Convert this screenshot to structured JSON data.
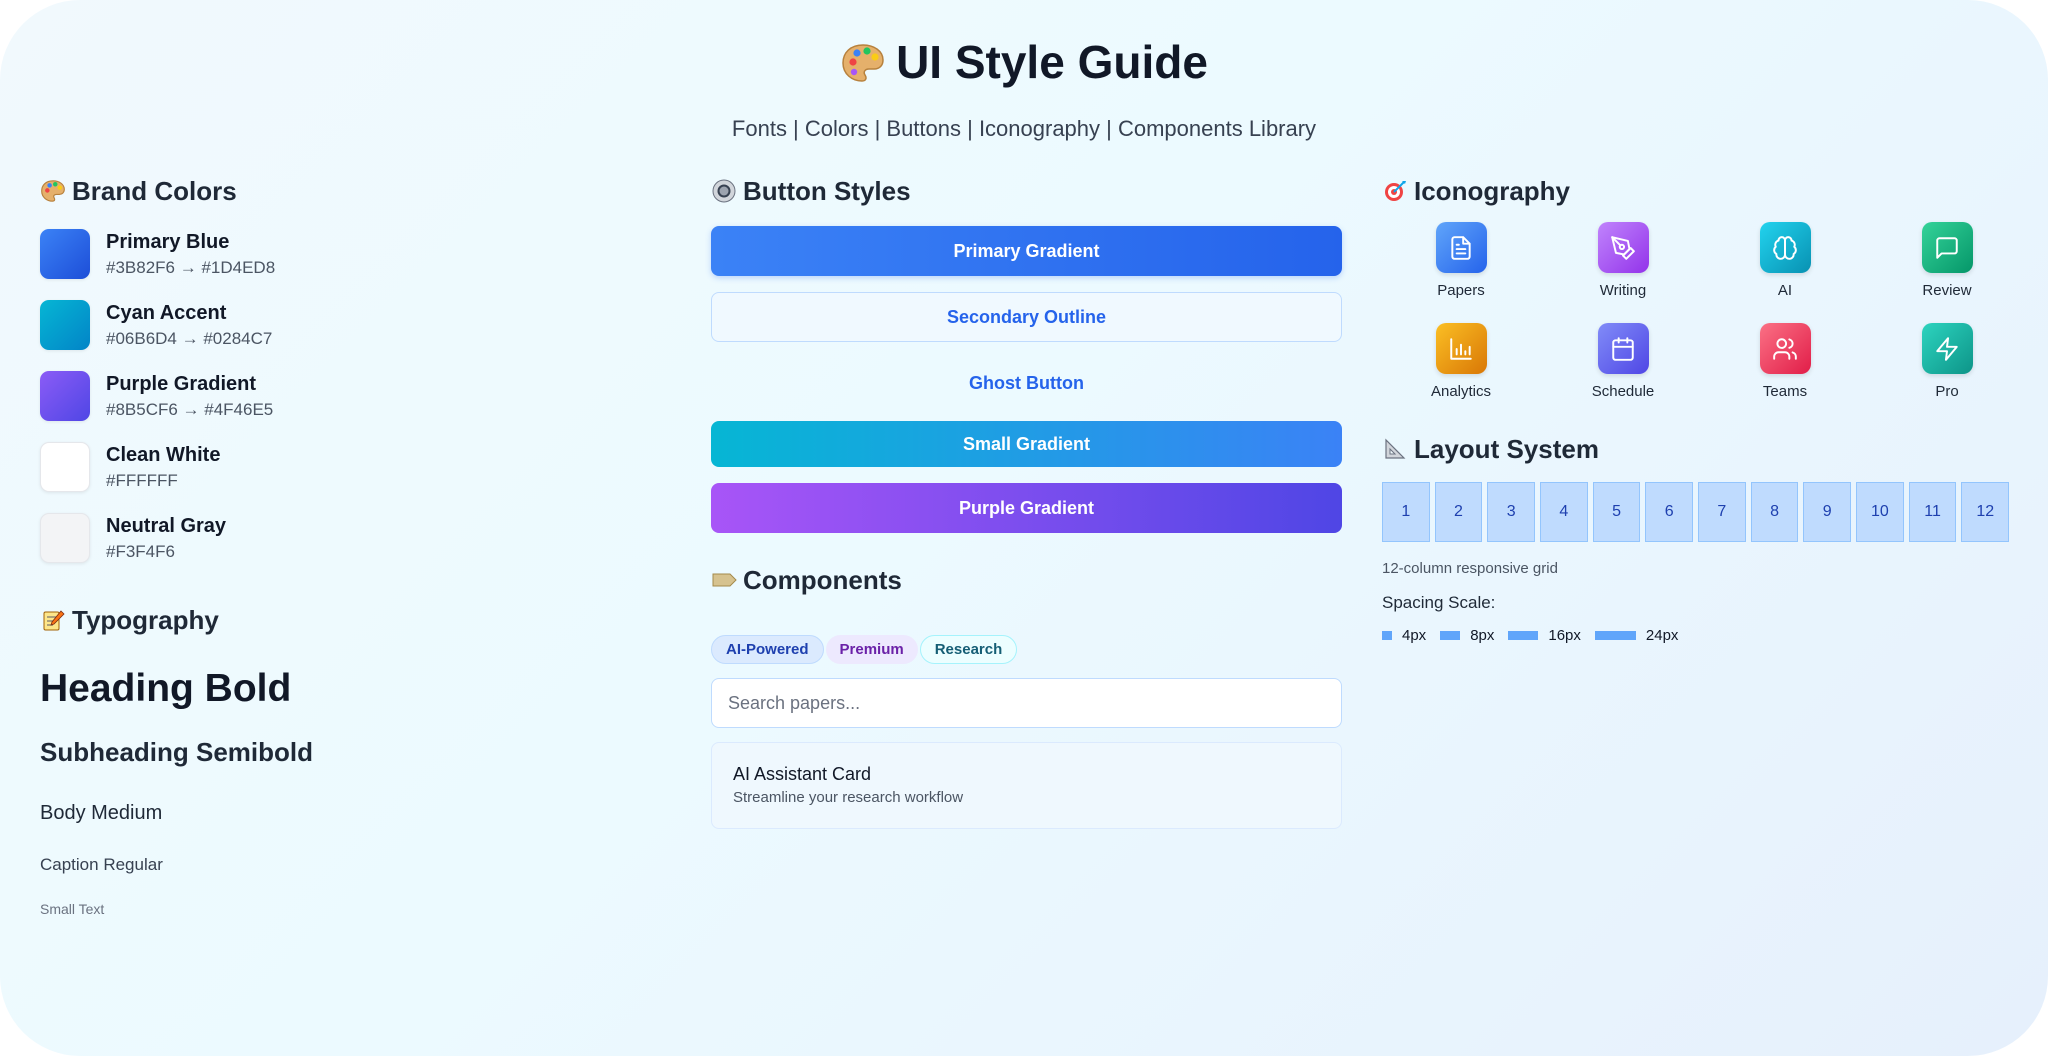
{
  "header": {
    "title": "UI Style Guide",
    "subtitle": "Fonts | Colors | Buttons | Iconography | Components Library"
  },
  "brand_colors": {
    "title": "Brand Colors",
    "items": [
      {
        "name": "Primary Blue",
        "hex": "#3B82F6 → #1D4ED8",
        "color_from": "#3B82F6",
        "color_to": "#1D4ED8"
      },
      {
        "name": "Cyan Accent",
        "hex": "#06B6D4 → #0284C7",
        "color_from": "#06B6D4",
        "color_to": "#0284C7"
      },
      {
        "name": "Purple Gradient",
        "hex": "#8B5CF6 → #4F46E5",
        "color_from": "#8B5CF6",
        "color_to": "#4F46E5"
      },
      {
        "name": "Clean White",
        "hex": "#FFFFFF",
        "color_from": "#FFFFFF",
        "color_to": "#FFFFFF"
      },
      {
        "name": "Neutral Gray",
        "hex": "#F3F4F6",
        "color_from": "#F3F4F6",
        "color_to": "#F3F4F6"
      }
    ]
  },
  "typography": {
    "title": "Typography",
    "heading": "Heading Bold",
    "subheading": "Subheading Semibold",
    "body": "Body Medium",
    "caption": "Caption Regular",
    "small": "Small Text"
  },
  "buttons": {
    "title": "Button Styles",
    "primary": "Primary Gradient",
    "secondary": "Secondary Outline",
    "ghost": "Ghost Button",
    "small": "Small Gradient",
    "purple": "Purple Gradient"
  },
  "components": {
    "title": "Components",
    "tags": [
      "AI-Powered",
      "Premium",
      "Research"
    ],
    "search_placeholder": "Search papers...",
    "card_title": "AI Assistant Card",
    "card_subtitle": "Streamline your research workflow"
  },
  "iconography": {
    "title": "Iconography",
    "items": [
      {
        "label": "Papers",
        "icon": "document-icon",
        "color": "#3B82F6"
      },
      {
        "label": "Writing",
        "icon": "pen-icon",
        "color": "#A855F7"
      },
      {
        "label": "AI",
        "icon": "brain-icon",
        "color": "#06B6D4"
      },
      {
        "label": "Review",
        "icon": "message-icon",
        "color": "#10B981"
      },
      {
        "label": "Analytics",
        "icon": "bar-chart-icon",
        "color": "#F59E0B"
      },
      {
        "label": "Schedule",
        "icon": "calendar-icon",
        "color": "#6366F1"
      },
      {
        "label": "Teams",
        "icon": "users-icon",
        "color": "#F43F5E"
      },
      {
        "label": "Pro",
        "icon": "lightning-icon",
        "color": "#14B8A6"
      }
    ]
  },
  "layout_system": {
    "title": "Layout System",
    "columns": [
      "1",
      "2",
      "3",
      "4",
      "5",
      "6",
      "7",
      "8",
      "9",
      "10",
      "11",
      "12"
    ],
    "caption": "12-column responsive grid",
    "spacing_title": "Spacing Scale:",
    "spacing": [
      "4px",
      "8px",
      "16px",
      "24px"
    ]
  }
}
